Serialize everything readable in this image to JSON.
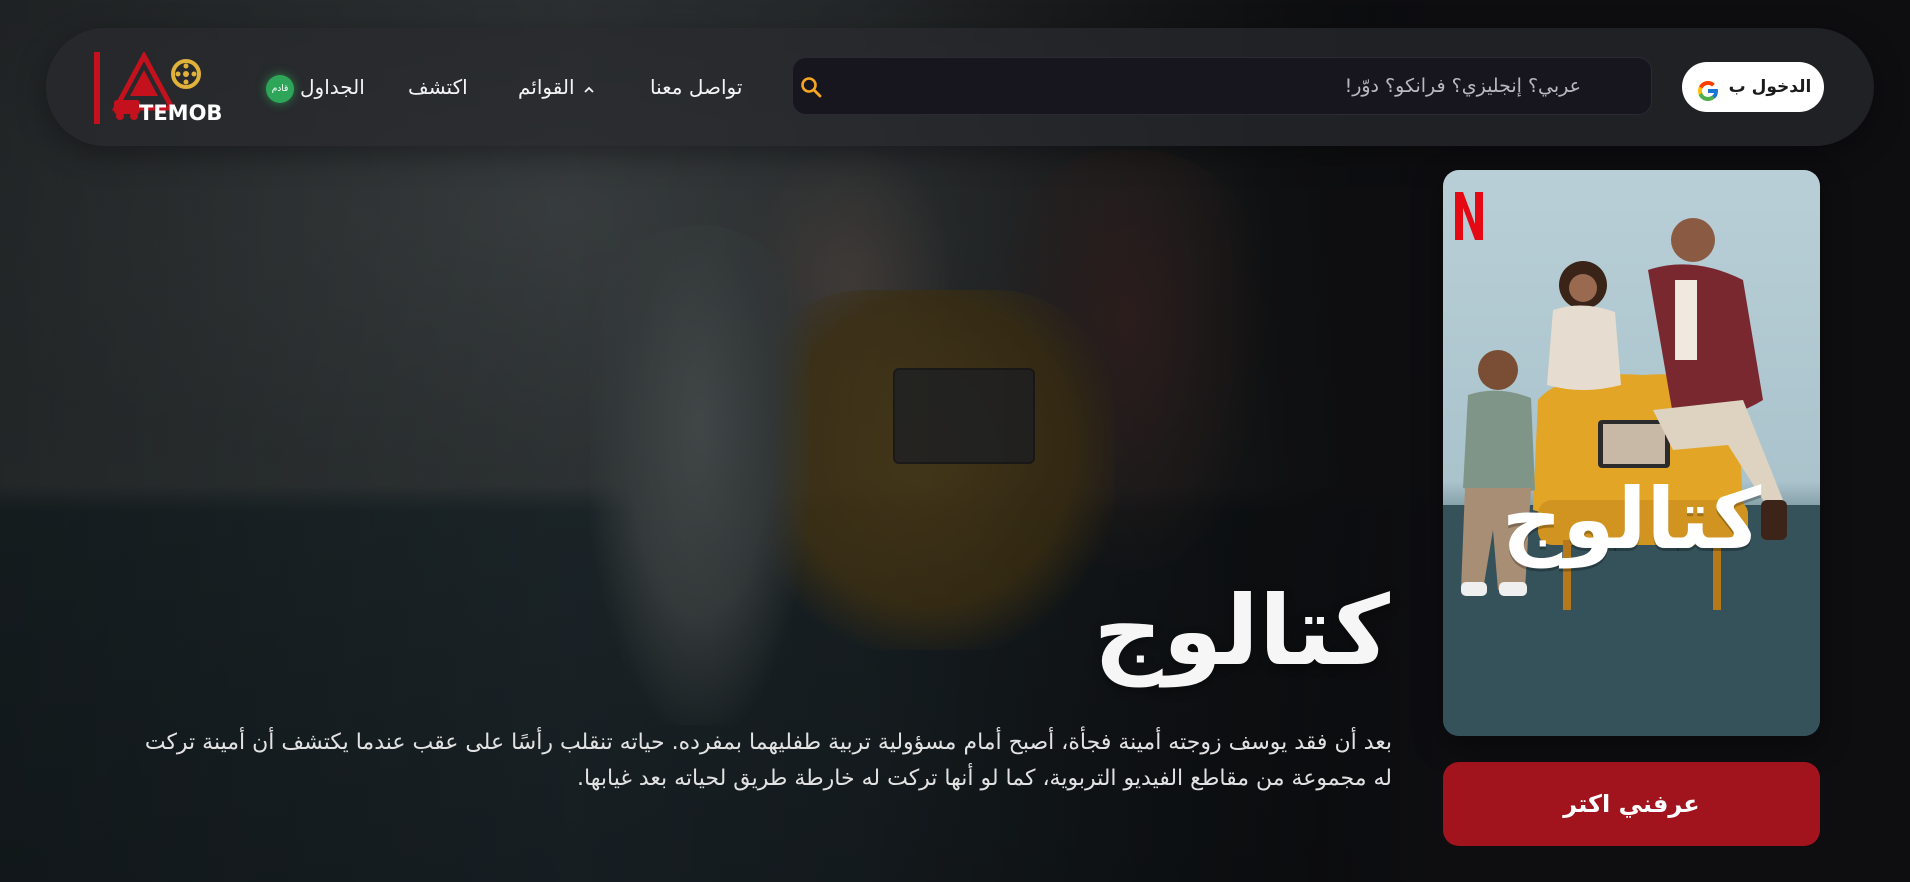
{
  "brand": {
    "logo_text": "TEMOB"
  },
  "nav": {
    "tables_label": "الجداول",
    "tables_badge": "قادم",
    "discover_label": "اكتشف",
    "lists_label": "القوائم",
    "contact_label": "تواصل معنا"
  },
  "search": {
    "placeholder": "عربي؟ إنجليزي؟ فرانكو؟ دوّر!"
  },
  "auth": {
    "login_label": "الدخول ب"
  },
  "hero": {
    "title": "كتالوج",
    "description": "بعد أن فقد يوسف زوجته أمينة فجأة، أصبح أمام مسؤولية تربية طفليهما بمفرده. حياته تنقلب رأسًا على عقب عندما يكتشف أن أمينة تركت له مجموعة من مقاطع الفيديو التربوية، كما لو أنها تركت له خارطة طريق لحياته بعد غيابها.",
    "poster_title_art": "كتالوج",
    "cta_label": "عرفني اكتر"
  },
  "colors": {
    "accent": "#a1141d",
    "badge_green": "#2ea65a",
    "search_icon": "#f5a623",
    "netflix_red": "#e50914"
  },
  "icons": {
    "search": "search-icon",
    "google": "google-icon",
    "chevron": "chevron-up-icon",
    "netflix": "netflix-logo-icon"
  }
}
